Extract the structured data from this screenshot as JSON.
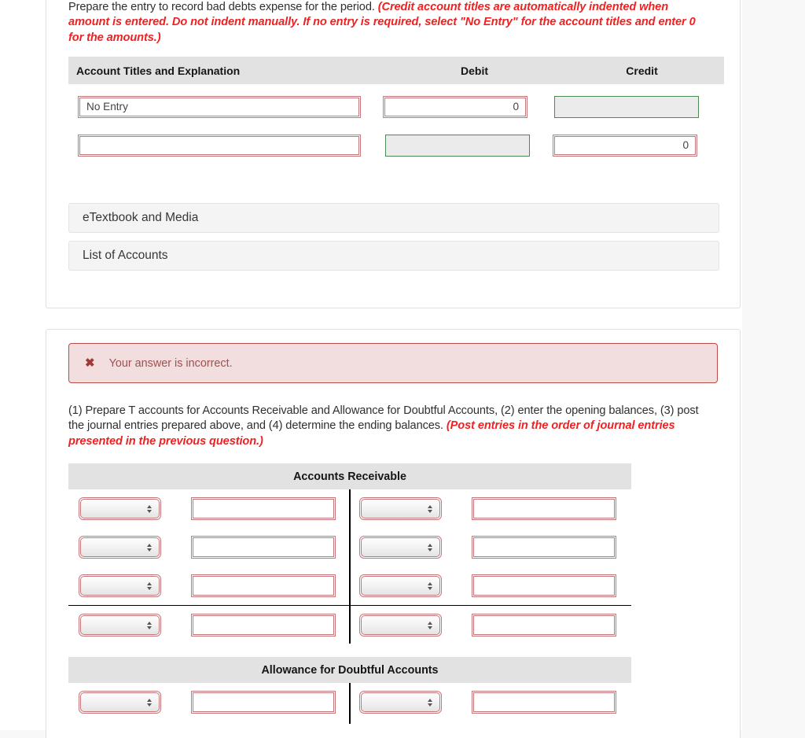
{
  "journal_card": {
    "prompt_plain": "Prepare the entry to record bad debts expense for the period. ",
    "prompt_hint": "(Credit account titles are automatically indented when amount is entered. Do not indent manually. If no entry is required, select \"No Entry\" for the account titles and enter 0 for the amounts.)",
    "table": {
      "headers": {
        "account": "Account Titles and Explanation",
        "debit": "Debit",
        "credit": "Credit"
      },
      "rows": [
        {
          "account_value": "No Entry",
          "account_state": "error",
          "debit_value": "0",
          "debit_state": "error",
          "credit_value": "",
          "credit_state": "disabled"
        },
        {
          "account_value": "",
          "account_state": "error",
          "debit_value": "",
          "debit_state": "disabled",
          "credit_value": "0",
          "credit_state": "error"
        }
      ]
    },
    "buttons": {
      "etextbook": "eTextbook and Media",
      "list_of_accounts": "List of Accounts"
    }
  },
  "taccount_card": {
    "banner": {
      "icon": "x-mark-icon",
      "message": "Your answer is incorrect.",
      "bg_color": "#f2dede",
      "border_color": "#b94a48",
      "text_color": "#a05050"
    },
    "prompt_plain": "(1) Prepare T accounts for Accounts Receivable and Allowance for Doubtful Accounts, (2) enter the opening balances, (3) post the journal entries prepared above, and (4) determine the ending balances. ",
    "prompt_hint": "(Post entries in the order of journal entries presented in the previous question.)",
    "taccounts": [
      {
        "title": "Accounts Receivable",
        "rows": [
          {
            "left_select": "",
            "left_amount": "",
            "right_select": "",
            "right_amount": "",
            "after_rule": false
          },
          {
            "left_select": "",
            "left_amount": "",
            "right_select": "",
            "right_amount": "",
            "after_rule": false
          },
          {
            "left_select": "",
            "left_amount": "",
            "right_select": "",
            "right_amount": "",
            "after_rule": false
          },
          {
            "left_select": "",
            "left_amount": "",
            "right_select": "",
            "right_amount": "",
            "after_rule": true
          }
        ]
      },
      {
        "title": "Allowance for Doubtful Accounts",
        "rows": [
          {
            "left_select": "",
            "left_amount": "",
            "right_select": "",
            "right_amount": "",
            "after_rule": false
          }
        ]
      }
    ]
  },
  "colors": {
    "error_border": "#c4787c",
    "valid_border": "#4c8a55",
    "hint_red": "#ee2222",
    "header_gray": "#e2e2e2"
  }
}
